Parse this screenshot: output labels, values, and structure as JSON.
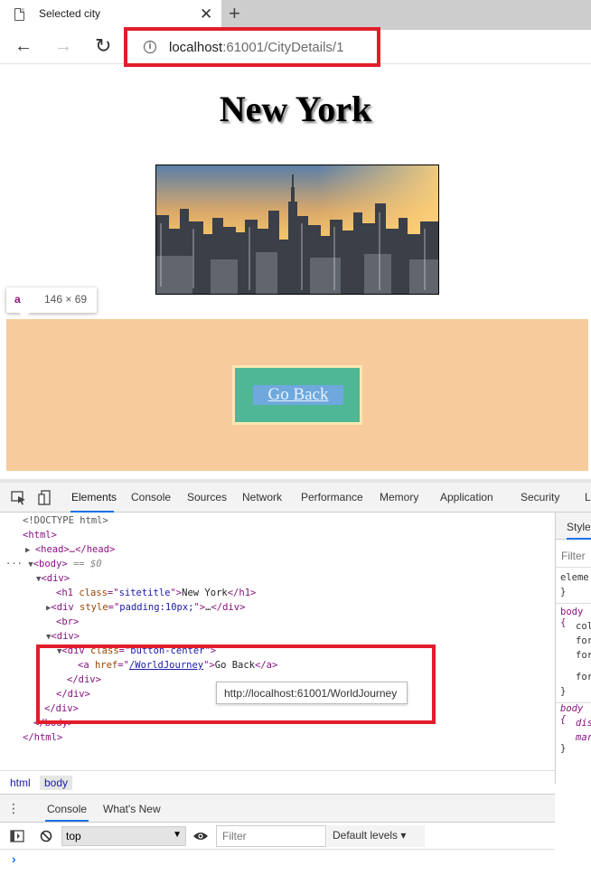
{
  "browser": {
    "tab_title": "Selected city",
    "tab_close": "✕",
    "new_tab": "+",
    "url_host": "localhost",
    "url_rest": ":61001/CityDetails/1",
    "back_icon": "←",
    "forward_icon": "→",
    "reload_icon": "↻",
    "info_icon": "i"
  },
  "page": {
    "title": "New York",
    "inspector_tag": "a",
    "inspector_dims": "146 × 69",
    "button_label": "Go Back"
  },
  "devtools": {
    "tabs": [
      "Elements",
      "Console",
      "Sources",
      "Network",
      "Performance",
      "Memory",
      "Application",
      "Security",
      "L"
    ],
    "active_tab": "Elements",
    "dom": {
      "doctype": "<!DOCTYPE html>",
      "html_open": "<html>",
      "head": "<head>…</head>",
      "body_open": "<body>",
      "body_eq": " == $0",
      "div_open": "<div>",
      "h1_tag": "h1",
      "h1_attr": "class",
      "h1_val": "sitetitle",
      "h1_text": "New York",
      "div_style_attr": "style",
      "div_style_val": "padding:10px;",
      "br": "<br>",
      "div2_open": "<div>",
      "div_bc_attr": "class",
      "div_bc_val": "button-center",
      "a_attr": "href",
      "a_val": "/WorldJourney",
      "a_text": "Go Back",
      "div_close": "</div>",
      "body_close": "</body>",
      "html_close": "</html>"
    },
    "tooltip": "http://localhost:61001/WorldJourney",
    "styles": {
      "tab": "Styles",
      "filter": "Filter",
      "rule1": "eleme",
      "rule1_close": "}",
      "rule2": "body {",
      "rule2_p1": "col",
      "rule2_p2": "for",
      "rule2_p3": "for",
      "rule2_p4": "for",
      "rule2_close": "}",
      "rule3": "body {",
      "rule3_p1": "dis",
      "rule3_p2": "mar",
      "rule3_close": "}"
    },
    "breadcrumbs": [
      "html",
      "body"
    ],
    "drawer_tabs": [
      "Console",
      "What's New"
    ],
    "drawer_dots": "⋮",
    "console_context": "top",
    "console_filter_placeholder": "Filter",
    "console_levels": "Default levels ▾",
    "prompt": "›"
  }
}
